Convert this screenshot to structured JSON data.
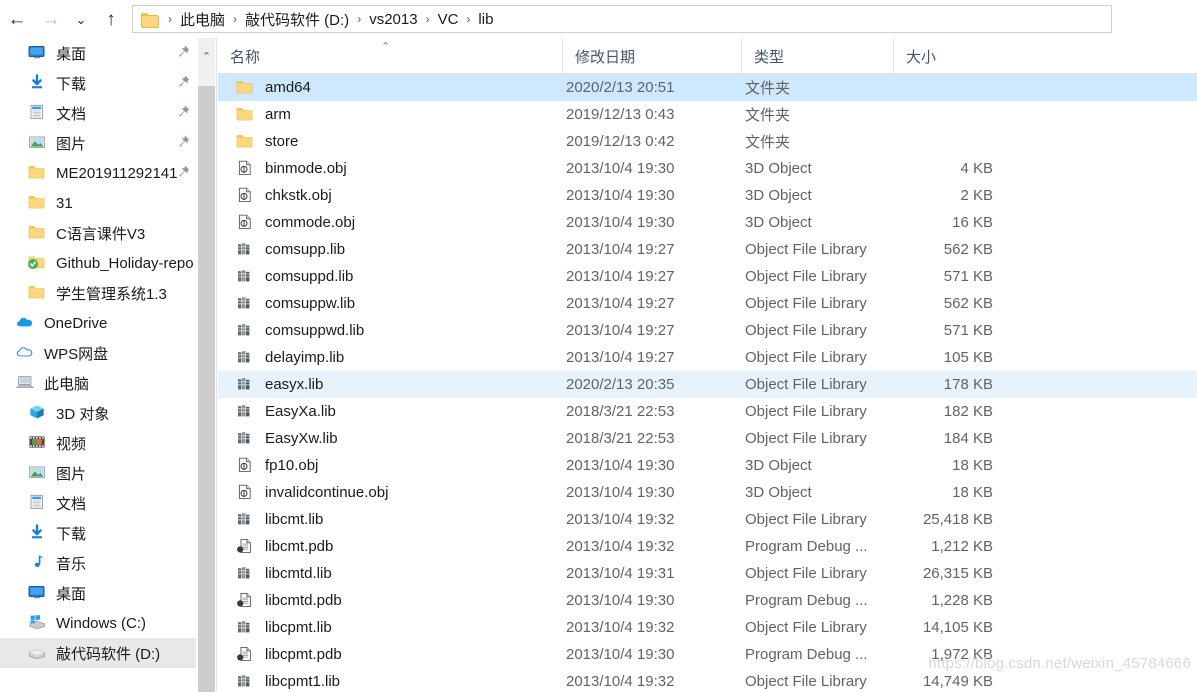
{
  "addressbar": {
    "back_icon": "arrow-left-icon",
    "forward_icon": "arrow-right-icon",
    "history_icon": "chevron-down-icon",
    "up_icon": "arrow-up-icon",
    "back_label": "←",
    "forward_label": "→",
    "history_label": "⌄",
    "up_label": "↑",
    "breadcrumb": [
      "此电脑",
      "敲代码软件 (D:)",
      "vs2013",
      "VC",
      "lib"
    ],
    "separator": "›"
  },
  "sidebar": {
    "scroll_up_label": "⌃",
    "items": [
      {
        "label": "桌面",
        "icon": "desktop-icon",
        "pinned": true,
        "indent": 1,
        "selected": false
      },
      {
        "label": "下载",
        "icon": "download-icon",
        "pinned": true,
        "indent": 1,
        "selected": false
      },
      {
        "label": "文档",
        "icon": "documents-icon",
        "pinned": true,
        "indent": 1,
        "selected": false
      },
      {
        "label": "图片",
        "icon": "pictures-icon",
        "pinned": true,
        "indent": 1,
        "selected": false
      },
      {
        "label": "ME201911292141",
        "icon": "folder-icon",
        "pinned": true,
        "indent": 1,
        "selected": false
      },
      {
        "label": "31",
        "icon": "folder-icon",
        "pinned": false,
        "indent": 1,
        "selected": false
      },
      {
        "label": "C语言课件V3",
        "icon": "folder-icon",
        "pinned": false,
        "indent": 1,
        "selected": false
      },
      {
        "label": "Github_Holiday-repo",
        "icon": "synced-folder-icon",
        "pinned": false,
        "indent": 1,
        "selected": false
      },
      {
        "label": "学生管理系统1.3",
        "icon": "folder-icon",
        "pinned": false,
        "indent": 1,
        "selected": false
      },
      {
        "label": "OneDrive",
        "icon": "onedrive-icon",
        "pinned": false,
        "indent": 0,
        "selected": false
      },
      {
        "label": "WPS网盘",
        "icon": "wps-cloud-icon",
        "pinned": false,
        "indent": 0,
        "selected": false
      },
      {
        "label": "此电脑",
        "icon": "this-pc-icon",
        "pinned": false,
        "indent": 0,
        "selected": false
      },
      {
        "label": "3D 对象",
        "icon": "3d-objects-icon",
        "pinned": false,
        "indent": 1,
        "selected": false
      },
      {
        "label": "视频",
        "icon": "videos-icon",
        "pinned": false,
        "indent": 1,
        "selected": false
      },
      {
        "label": "图片",
        "icon": "pictures-icon",
        "pinned": false,
        "indent": 1,
        "selected": false
      },
      {
        "label": "文档",
        "icon": "documents-icon",
        "pinned": false,
        "indent": 1,
        "selected": false
      },
      {
        "label": "下载",
        "icon": "download-icon",
        "pinned": false,
        "indent": 1,
        "selected": false
      },
      {
        "label": "音乐",
        "icon": "music-icon",
        "pinned": false,
        "indent": 1,
        "selected": false
      },
      {
        "label": "桌面",
        "icon": "desktop-icon",
        "pinned": false,
        "indent": 1,
        "selected": false
      },
      {
        "label": "Windows (C:)",
        "icon": "windows-drive-icon",
        "pinned": false,
        "indent": 1,
        "selected": false
      },
      {
        "label": "敲代码软件 (D:)",
        "icon": "drive-icon",
        "pinned": false,
        "indent": 1,
        "selected": true
      }
    ]
  },
  "filepane": {
    "columns": [
      {
        "label": "名称",
        "key": "name"
      },
      {
        "label": "修改日期",
        "key": "date"
      },
      {
        "label": "类型",
        "key": "type"
      },
      {
        "label": "大小",
        "key": "size"
      }
    ],
    "sort_indicator": "⌃",
    "rows": [
      {
        "name": "amd64",
        "date": "2020/2/13 20:51",
        "type": "文件夹",
        "size": "",
        "icon": "folder-icon",
        "state": "selected"
      },
      {
        "name": "arm",
        "date": "2019/12/13 0:43",
        "type": "文件夹",
        "size": "",
        "icon": "folder-icon",
        "state": ""
      },
      {
        "name": "store",
        "date": "2019/12/13 0:42",
        "type": "文件夹",
        "size": "",
        "icon": "folder-icon",
        "state": ""
      },
      {
        "name": "binmode.obj",
        "date": "2013/10/4 19:30",
        "type": "3D Object",
        "size": "4 KB",
        "icon": "obj-file-icon",
        "state": ""
      },
      {
        "name": "chkstk.obj",
        "date": "2013/10/4 19:30",
        "type": "3D Object",
        "size": "2 KB",
        "icon": "obj-file-icon",
        "state": ""
      },
      {
        "name": "commode.obj",
        "date": "2013/10/4 19:30",
        "type": "3D Object",
        "size": "16 KB",
        "icon": "obj-file-icon",
        "state": ""
      },
      {
        "name": "comsupp.lib",
        "date": "2013/10/4 19:27",
        "type": "Object File Library",
        "size": "562 KB",
        "icon": "lib-file-icon",
        "state": ""
      },
      {
        "name": "comsuppd.lib",
        "date": "2013/10/4 19:27",
        "type": "Object File Library",
        "size": "571 KB",
        "icon": "lib-file-icon",
        "state": ""
      },
      {
        "name": "comsuppw.lib",
        "date": "2013/10/4 19:27",
        "type": "Object File Library",
        "size": "562 KB",
        "icon": "lib-file-icon",
        "state": ""
      },
      {
        "name": "comsuppwd.lib",
        "date": "2013/10/4 19:27",
        "type": "Object File Library",
        "size": "571 KB",
        "icon": "lib-file-icon",
        "state": ""
      },
      {
        "name": "delayimp.lib",
        "date": "2013/10/4 19:27",
        "type": "Object File Library",
        "size": "105 KB",
        "icon": "lib-file-icon",
        "state": ""
      },
      {
        "name": "easyx.lib",
        "date": "2020/2/13 20:35",
        "type": "Object File Library",
        "size": "178 KB",
        "icon": "lib-file-icon",
        "state": "hover"
      },
      {
        "name": "EasyXa.lib",
        "date": "2018/3/21 22:53",
        "type": "Object File Library",
        "size": "182 KB",
        "icon": "lib-file-icon",
        "state": ""
      },
      {
        "name": "EasyXw.lib",
        "date": "2018/3/21 22:53",
        "type": "Object File Library",
        "size": "184 KB",
        "icon": "lib-file-icon",
        "state": ""
      },
      {
        "name": "fp10.obj",
        "date": "2013/10/4 19:30",
        "type": "3D Object",
        "size": "18 KB",
        "icon": "obj-file-icon",
        "state": ""
      },
      {
        "name": "invalidcontinue.obj",
        "date": "2013/10/4 19:30",
        "type": "3D Object",
        "size": "18 KB",
        "icon": "obj-file-icon",
        "state": ""
      },
      {
        "name": "libcmt.lib",
        "date": "2013/10/4 19:32",
        "type": "Object File Library",
        "size": "25,418 KB",
        "icon": "lib-file-icon",
        "state": ""
      },
      {
        "name": "libcmt.pdb",
        "date": "2013/10/4 19:32",
        "type": "Program Debug ...",
        "size": "1,212 KB",
        "icon": "pdb-file-icon",
        "state": ""
      },
      {
        "name": "libcmtd.lib",
        "date": "2013/10/4 19:31",
        "type": "Object File Library",
        "size": "26,315 KB",
        "icon": "lib-file-icon",
        "state": ""
      },
      {
        "name": "libcmtd.pdb",
        "date": "2013/10/4 19:30",
        "type": "Program Debug ...",
        "size": "1,228 KB",
        "icon": "pdb-file-icon",
        "state": ""
      },
      {
        "name": "libcpmt.lib",
        "date": "2013/10/4 19:32",
        "type": "Object File Library",
        "size": "14,105 KB",
        "icon": "lib-file-icon",
        "state": ""
      },
      {
        "name": "libcpmt.pdb",
        "date": "2013/10/4 19:30",
        "type": "Program Debug ...",
        "size": "1,972 KB",
        "icon": "pdb-file-icon",
        "state": ""
      },
      {
        "name": "libcpmt1.lib",
        "date": "2013/10/4 19:32",
        "type": "Object File Library",
        "size": "14,749 KB",
        "icon": "lib-file-icon",
        "state": ""
      }
    ]
  },
  "watermark": {
    "text": "https://blog.csdn.net/weixin_45784666"
  },
  "colors": {
    "selection": "#cde8ff",
    "hover": "#e6f3fd",
    "header_text": "#45566b",
    "secondary_text": "#636363",
    "folder": "#fbd87f"
  }
}
